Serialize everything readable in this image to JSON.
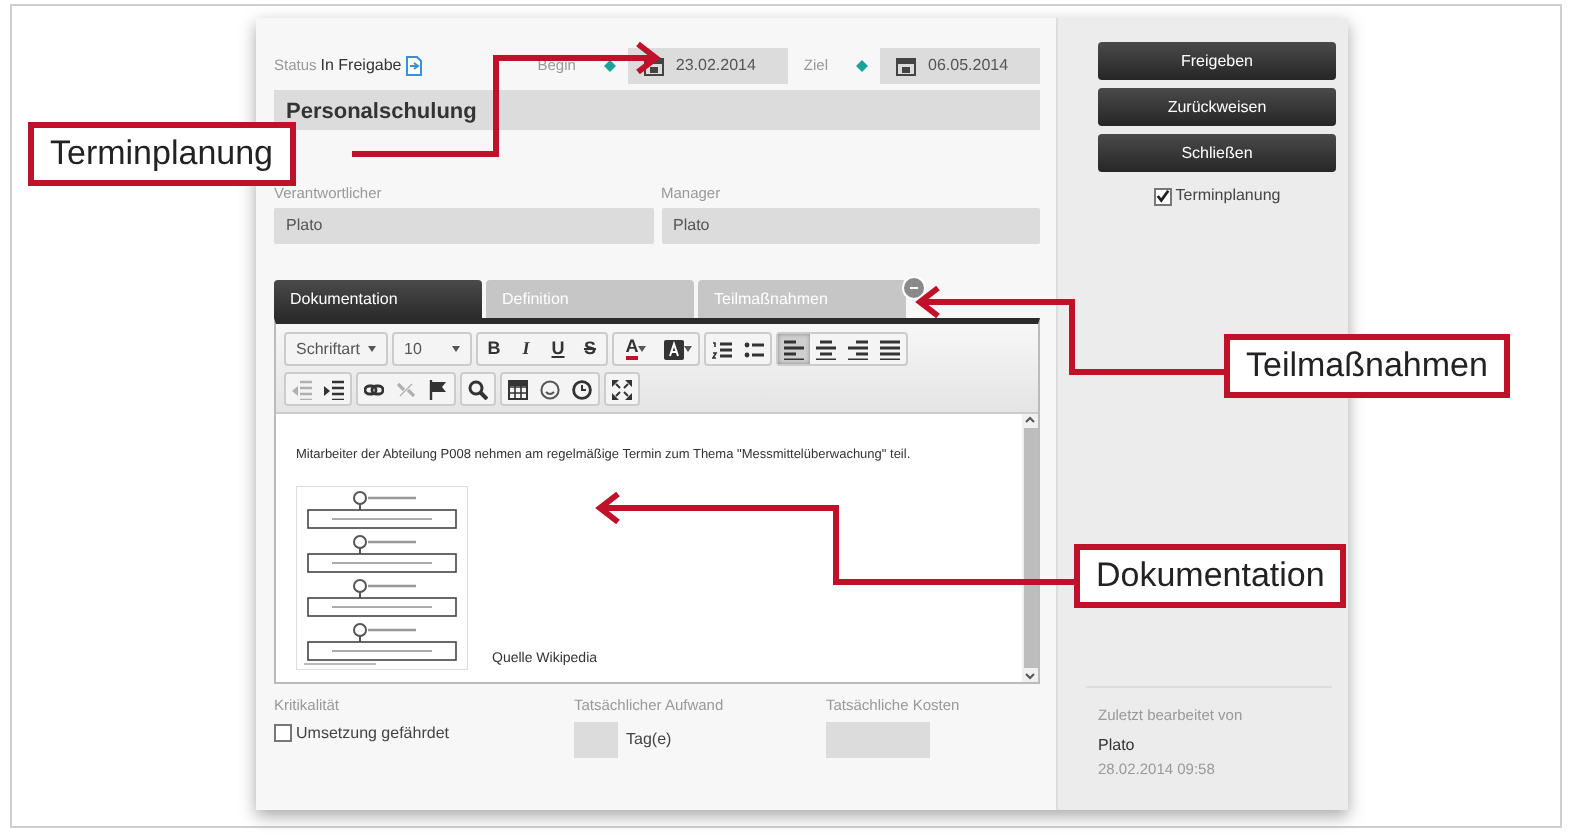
{
  "callouts": [
    {
      "label": "Terminplanung"
    },
    {
      "label": "Teilmaßnahmen"
    },
    {
      "label": "Dokumentation"
    }
  ],
  "status": {
    "label": "Status",
    "value": "In Freigabe"
  },
  "dates": [
    {
      "label": "Begin",
      "value": "23.02.2014"
    },
    {
      "label": "Ziel",
      "value": "06.05.2014"
    }
  ],
  "title": "Personalschulung",
  "people": [
    {
      "label": "Verantwortlicher",
      "value": "Plato"
    },
    {
      "label": "Manager",
      "value": "Plato"
    }
  ],
  "tabs": [
    {
      "label": "Dokumentation",
      "selected": true
    },
    {
      "label": "Definition",
      "selected": false
    },
    {
      "label": "Teilmaßnahmen",
      "selected": false
    }
  ],
  "toolbar": {
    "font": "Schriftart",
    "size": "10",
    "format_buttons": [
      {
        "label": "B"
      },
      {
        "label": "I"
      },
      {
        "label": "U"
      },
      {
        "label": "S"
      }
    ],
    "text_color": "A",
    "align_buttons": [
      {
        "selected": true
      },
      {
        "selected": false
      },
      {
        "selected": false
      },
      {
        "selected": false
      }
    ],
    "indent_buttons": [
      {
        "disabled": true
      },
      {
        "disabled": false
      }
    ],
    "link_buttons": [
      {
        "disabled": false
      },
      {
        "disabled": true
      },
      {
        "disabled": false
      }
    ]
  },
  "document": {
    "text": "Mitarbeiter der Abteilung P008 nehmen am regelmäßige Termin zum Thema \"Messmittelüberwachung\" teil.",
    "caption": "Quelle Wikipedia"
  },
  "criticality": {
    "label": "Kritikalität",
    "checkbox": "Umsetzung gefährdet",
    "checked": false
  },
  "effort": {
    "label": "Tatsächlicher Aufwand",
    "unit": "Tag(e)"
  },
  "cost": {
    "label": "Tatsächliche Kosten"
  },
  "actions": [
    {
      "label": "Freigeben"
    },
    {
      "label": "Zurückweisen"
    },
    {
      "label": "Schließen"
    }
  ],
  "option": {
    "label": "Terminplanung",
    "checked": true
  },
  "last_edit": {
    "label": "Zuletzt bearbeitet von",
    "user": "Plato",
    "time": "28.02.2014 09:58"
  }
}
